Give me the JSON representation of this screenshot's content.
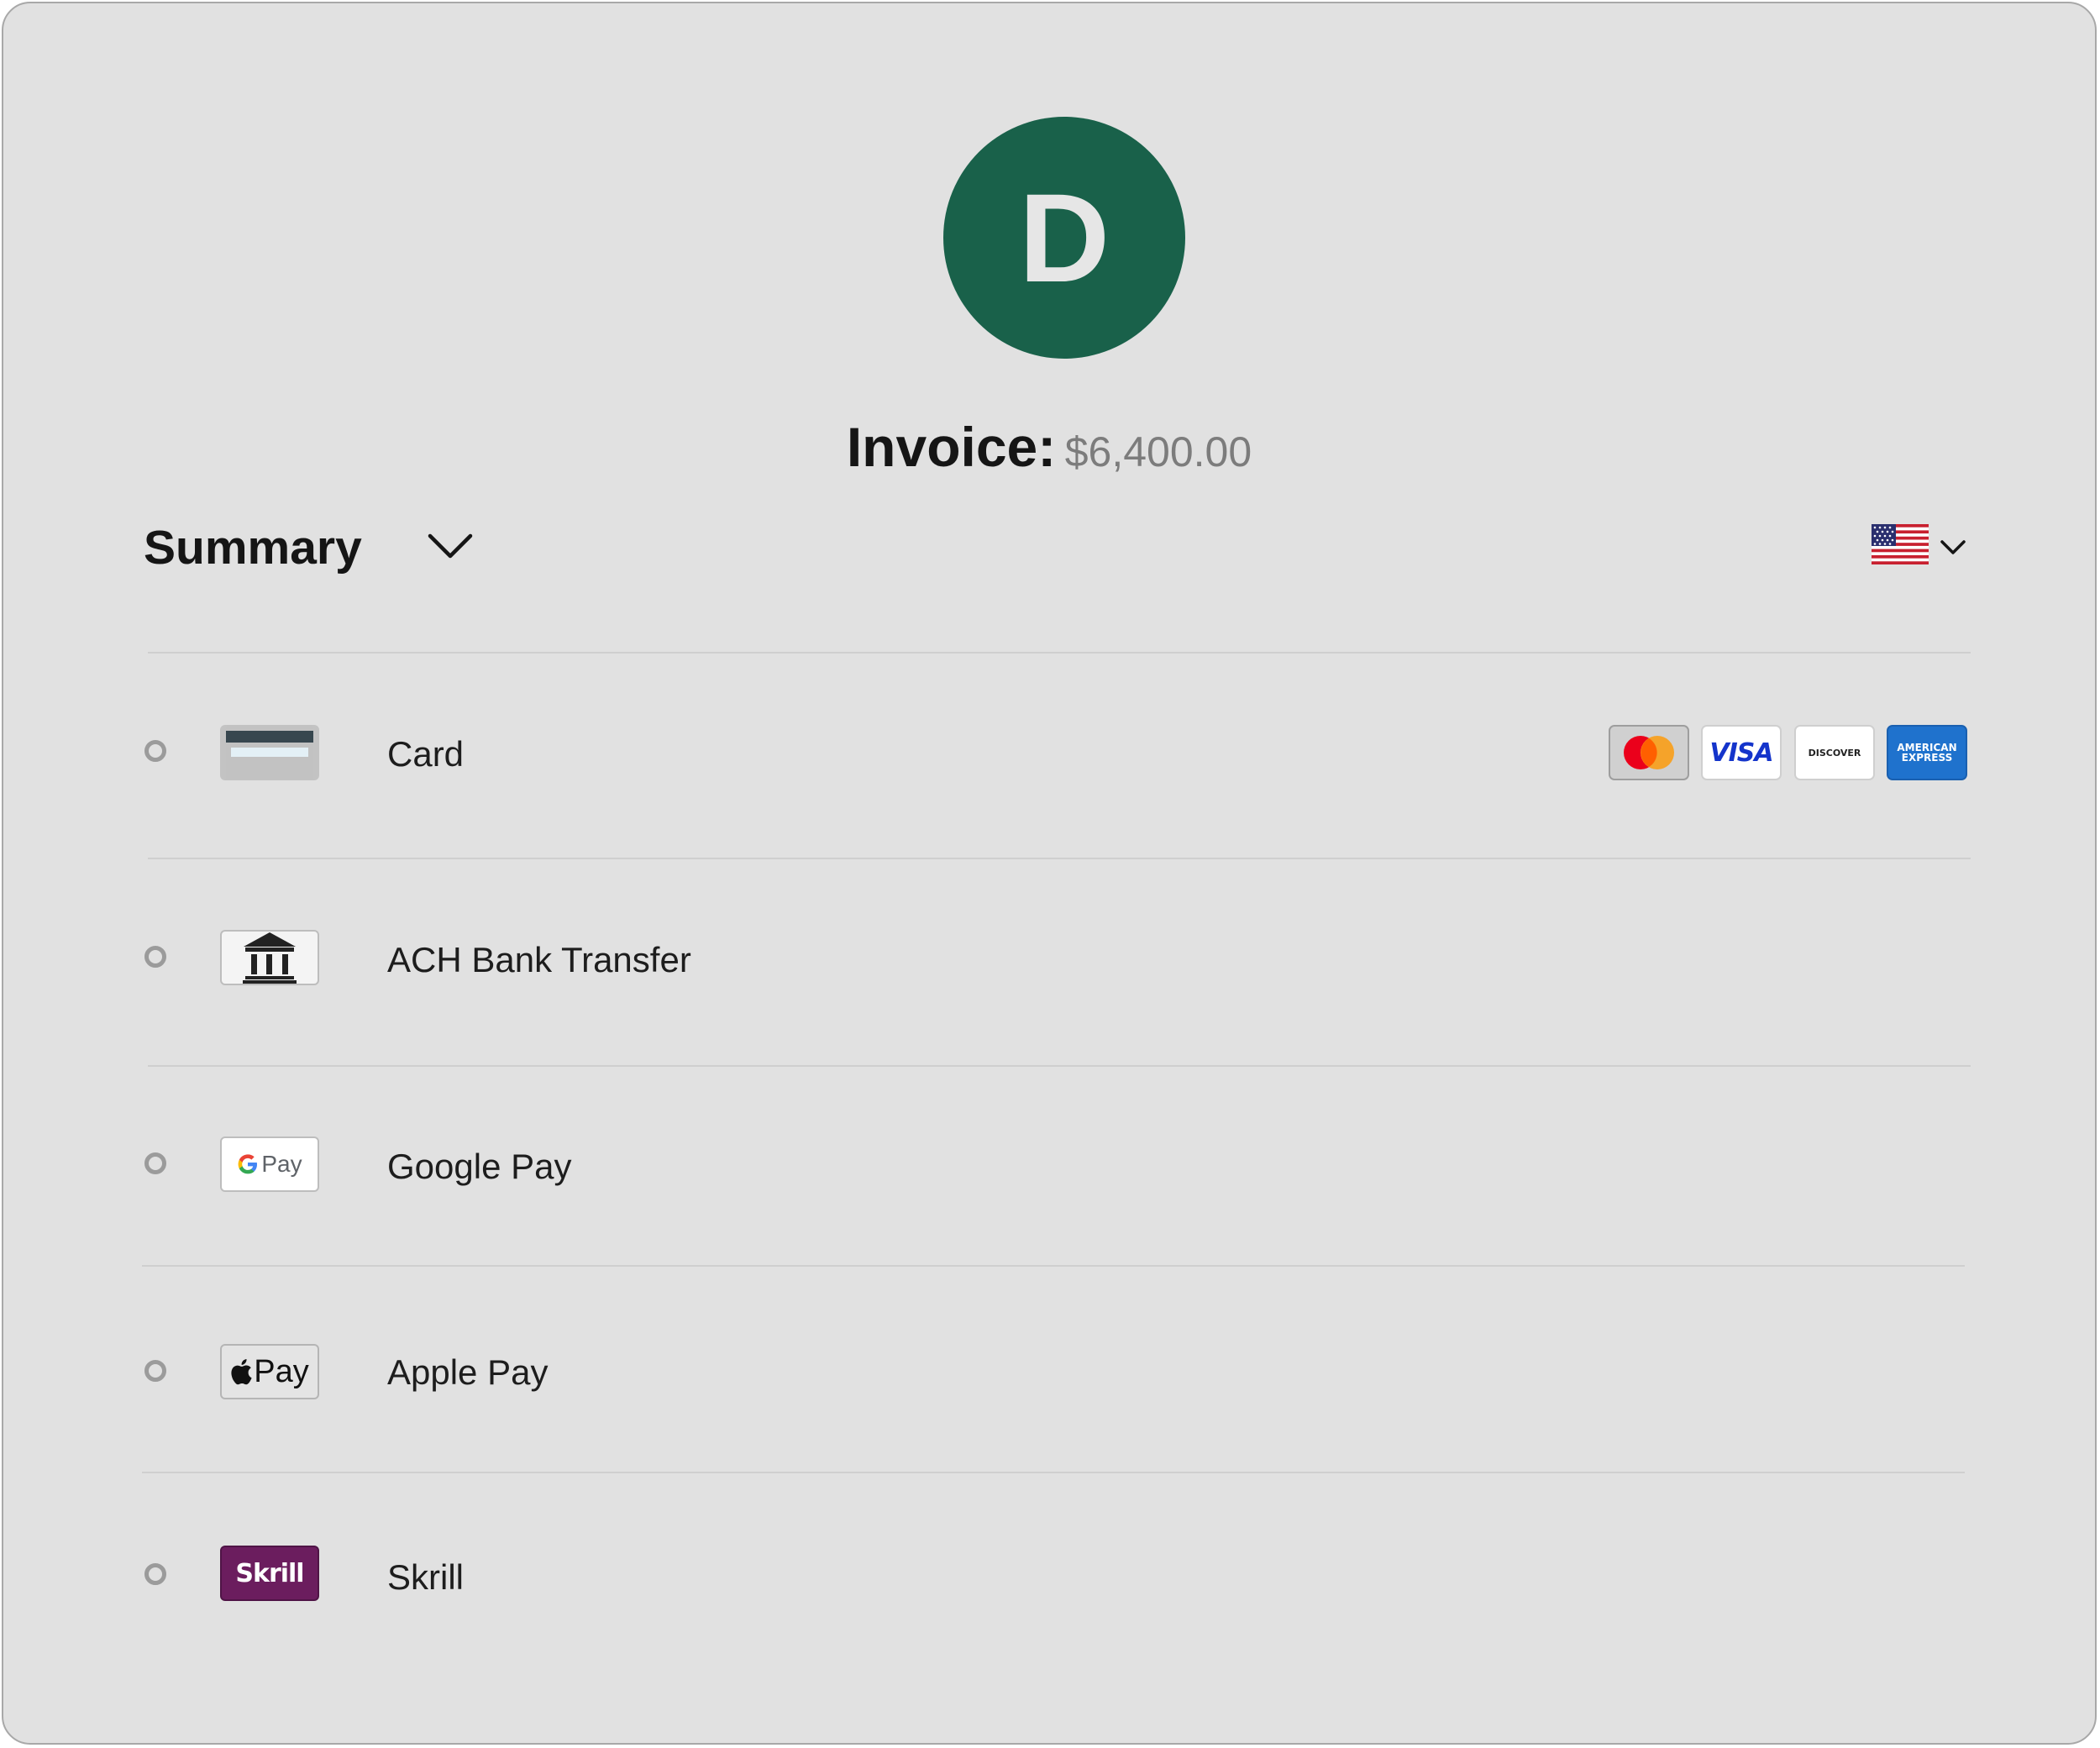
{
  "merchant": {
    "avatar_letter": "D",
    "avatar_color": "#19614a"
  },
  "invoice": {
    "label": "Invoice:",
    "amount": "$6,400.00"
  },
  "summary": {
    "label": "Summary",
    "toggle_icon": "chevron-down-icon"
  },
  "locale": {
    "flag_icon": "us-flag-icon",
    "dropdown_icon": "chevron-down-icon"
  },
  "payment_methods": [
    {
      "label": "Card",
      "icon": "credit-card-icon",
      "selected": false
    },
    {
      "label": "ACH Bank Transfer",
      "icon": "bank-icon",
      "selected": false
    },
    {
      "label": "Google Pay",
      "icon": "google-pay-icon",
      "icon_text": "Pay",
      "selected": false
    },
    {
      "label": "Apple Pay",
      "icon": "apple-pay-icon",
      "icon_text": "Pay",
      "selected": false
    },
    {
      "label": "Skrill",
      "icon": "skrill-icon",
      "icon_text": "Skrill",
      "selected": false
    }
  ],
  "card_brands": [
    {
      "name": "mastercard",
      "icon": "mastercard-icon"
    },
    {
      "name": "visa",
      "icon": "visa-icon",
      "text": "VISA"
    },
    {
      "name": "discover",
      "icon": "discover-icon",
      "text": "DISCOVER"
    },
    {
      "name": "amex",
      "icon": "amex-icon",
      "text_line1": "AMERICAN",
      "text_line2": "EXPRESS"
    }
  ],
  "colors": {
    "background": "#e1e1e1",
    "text": "#151515",
    "muted": "#7c7c7c",
    "skrill": "#6b1d5e",
    "amex": "#1f72cd",
    "visa": "#1434cb"
  }
}
